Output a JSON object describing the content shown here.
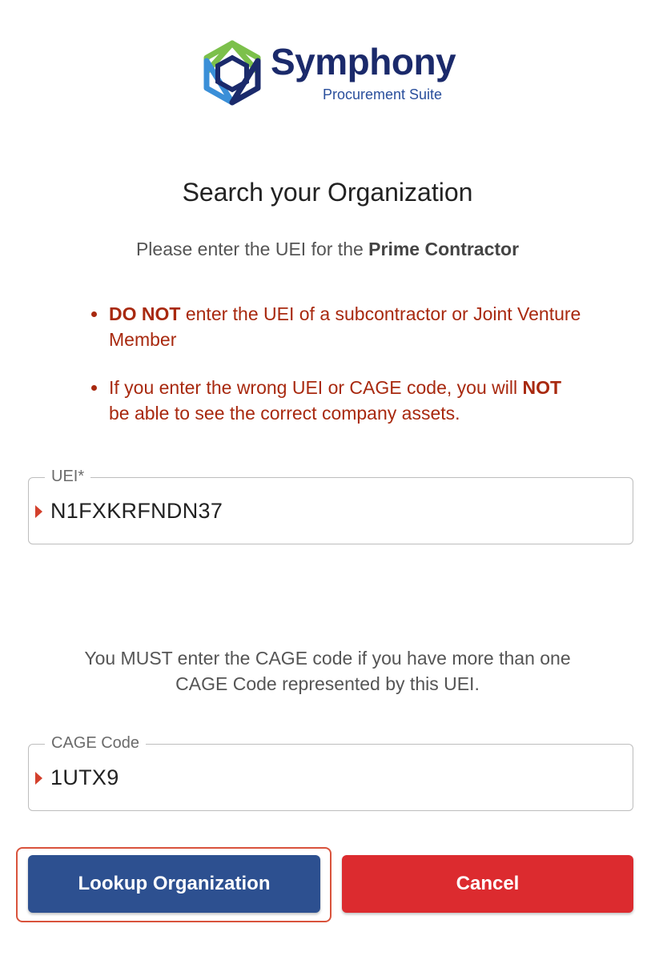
{
  "logo": {
    "brand": "Symphony",
    "suite": "Procurement Suite",
    "colors": {
      "green": "#7cc04b",
      "light_blue": "#3a8fd8",
      "navy": "#1b2a6b"
    }
  },
  "title": "Search your Organization",
  "subtitle": {
    "prefix": "Please enter the UEI for the ",
    "bold": "Prime Contractor"
  },
  "warnings": [
    {
      "bold": "DO NOT",
      "text_before": "",
      "text_after": " enter the UEI of a subcontractor or Joint Venture Member"
    },
    {
      "bold": "NOT",
      "text_before": "If you enter the wrong UEI or CAGE code, you will ",
      "text_after": " be able to see the correct company assets."
    }
  ],
  "uei_field": {
    "label": "UEI*",
    "value": "N1FXKRFNDN37"
  },
  "cage_note": "You MUST enter the CAGE code if you have more than one CAGE Code represented by this UEI.",
  "cage_field": {
    "label": "CAGE Code",
    "value": "1UTX9"
  },
  "buttons": {
    "lookup": "Lookup Organization",
    "cancel": "Cancel"
  },
  "colors": {
    "primary": "#2d5090",
    "danger": "#dc2b2f",
    "warning_text": "#a8290f",
    "focus_ring": "#d9533c"
  }
}
